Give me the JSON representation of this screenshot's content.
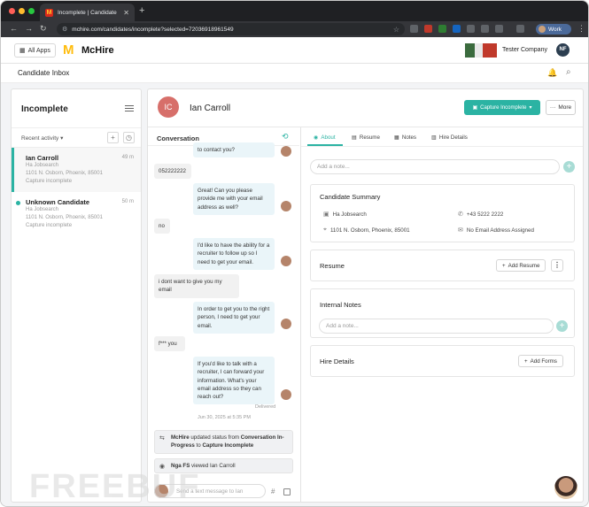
{
  "browser": {
    "tab_title": "Incomplete | Candidate Expe",
    "tab_close": "✕",
    "new_tab": "+",
    "url": "mchire.com/candidates/incomplete?selected=72036918961549",
    "work_label": "Work"
  },
  "header": {
    "all_apps": "All Apps",
    "logo_mark": "M",
    "logo_text": "McHire",
    "company": "Tester Company",
    "user_initials": "NF"
  },
  "subheader": {
    "title": "Candidate Inbox"
  },
  "left_panel": {
    "title": "Incomplete",
    "filter": "Recent activity",
    "candidates": [
      {
        "name": "Ian Carroll",
        "time": "49 m",
        "source": "Ha Jobsearch",
        "address": "1101 N. Osborn, Phoenix, 85001",
        "status": "Capture incomplete"
      },
      {
        "name": "Unknown Candidate",
        "time": "50 m",
        "source": "Ha Jobsearch",
        "address": "1101 N. Osborn, Phoenix, 85001",
        "status": "Capture incomplete"
      }
    ]
  },
  "candidate": {
    "initials": "IC",
    "name": "Ian Carroll",
    "status_button": "Capture Incomplete",
    "more_button": "More"
  },
  "conversation": {
    "header": "Conversation",
    "messages": [
      {
        "dir": "out",
        "text": "to contact you?"
      },
      {
        "dir": "in",
        "text": "052222222"
      },
      {
        "dir": "out",
        "text": "Great! Can you please provide me with your email address as well?"
      },
      {
        "dir": "in",
        "text": "no"
      },
      {
        "dir": "out",
        "text": "I'd like to have the ability for a recruiter to follow up so I need to get your email."
      },
      {
        "dir": "in",
        "text": "i dont want to give you my email"
      },
      {
        "dir": "out",
        "text": "In order to get you to the right person, I need to get your email."
      },
      {
        "dir": "in",
        "text": "f*** you"
      },
      {
        "dir": "out",
        "text": "If you'd like to talk with a recruiter, I can forward your information. What's your email address so they can reach out?"
      }
    ],
    "delivered": "Delivered",
    "timestamp": "Jun 30, 2025 at 5:35 PM",
    "system_1_actor": "McHire",
    "system_1_text": " updated status from ",
    "system_1_from": "Conversation In-Progress",
    "system_1_to_word": " to ",
    "system_1_to": "Capture Incomplete",
    "system_2_actor": "Nga FS",
    "system_2_text": " viewed Ian Carroll",
    "compose_placeholder": "Send a text message to Ian"
  },
  "details": {
    "tabs": [
      "About",
      "Resume",
      "Notes",
      "Hire Details"
    ],
    "note_placeholder": "Add a note...",
    "summary_title": "Candidate Summary",
    "source": "Ha Jobsearch",
    "phone": "+43 5222 2222",
    "address": "1101 N. Osborn, Phoenix, 85001",
    "email": "No Email Address Assigned",
    "resume_title": "Resume",
    "add_resume": "Add Resume",
    "internal_notes_title": "Internal Notes",
    "internal_note_placeholder": "Add a note...",
    "hire_details_title": "Hire Details",
    "add_forms": "Add Forms"
  },
  "watermark": "FREEBUF",
  "colors": {
    "accent": "#2bb3a3",
    "avatar": "#d76f6a",
    "logo": "#ffbc0d"
  }
}
